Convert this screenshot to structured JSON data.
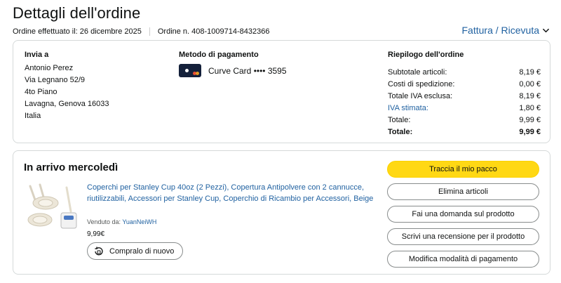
{
  "header": {
    "title": "Dettagli dell'ordine",
    "order_date": "Ordine effettuato il: 26 dicembre 2025",
    "order_number": "Ordine n. 408-1009714-8432366",
    "invoice_link": "Fattura / Ricevuta"
  },
  "shipping": {
    "title": "Invia a",
    "lines": [
      "Antonio Perez",
      "Via Legnano 52/9",
      "4to Piano",
      "Lavagna, Genova 16033",
      "Italia"
    ]
  },
  "payment": {
    "title": "Metodo di pagamento",
    "method": "Curve Card •••• 3595",
    "icon": "curve-card-icon"
  },
  "summary": {
    "title": "Riepilogo dell'ordine",
    "rows": [
      {
        "label": "Subtotale articoli:",
        "value": "8,19 €"
      },
      {
        "label": "Costi di spedizione:",
        "value": "0,00 €"
      },
      {
        "label": "Totale IVA esclusa:",
        "value": "8,19 €"
      },
      {
        "label": "IVA stimata:",
        "value": "1,80 €"
      },
      {
        "label": "Totale:",
        "value": "9,99 €"
      },
      {
        "label": "Totale:",
        "value": "9,99 €"
      }
    ]
  },
  "shipment": {
    "status": "In arrivo mercoledì",
    "product_title": "Coperchi per Stanley Cup 40oz (2 Pezzi), Copertura Antipolvere con 2 cannucce, riutilizzabili, Accessori per Stanley Cup, Coperchio di Ricambio per Accessori, Beige",
    "sold_by_label": "Venduto da:",
    "seller": "YuanNeiWH",
    "price": "9,99€",
    "buy_again": "Compralo di nuovo"
  },
  "actions": {
    "track": "Traccia il mio pacco",
    "remove": "Elimina articoli",
    "question": "Fai una domanda sul prodotto",
    "review": "Scrivi una recensione per il prodotto",
    "modify_payment": "Modifica modalità di pagamento"
  },
  "colors": {
    "link": "#2162a1",
    "primary_button": "#ffd814",
    "border": "#d5d9d9"
  }
}
